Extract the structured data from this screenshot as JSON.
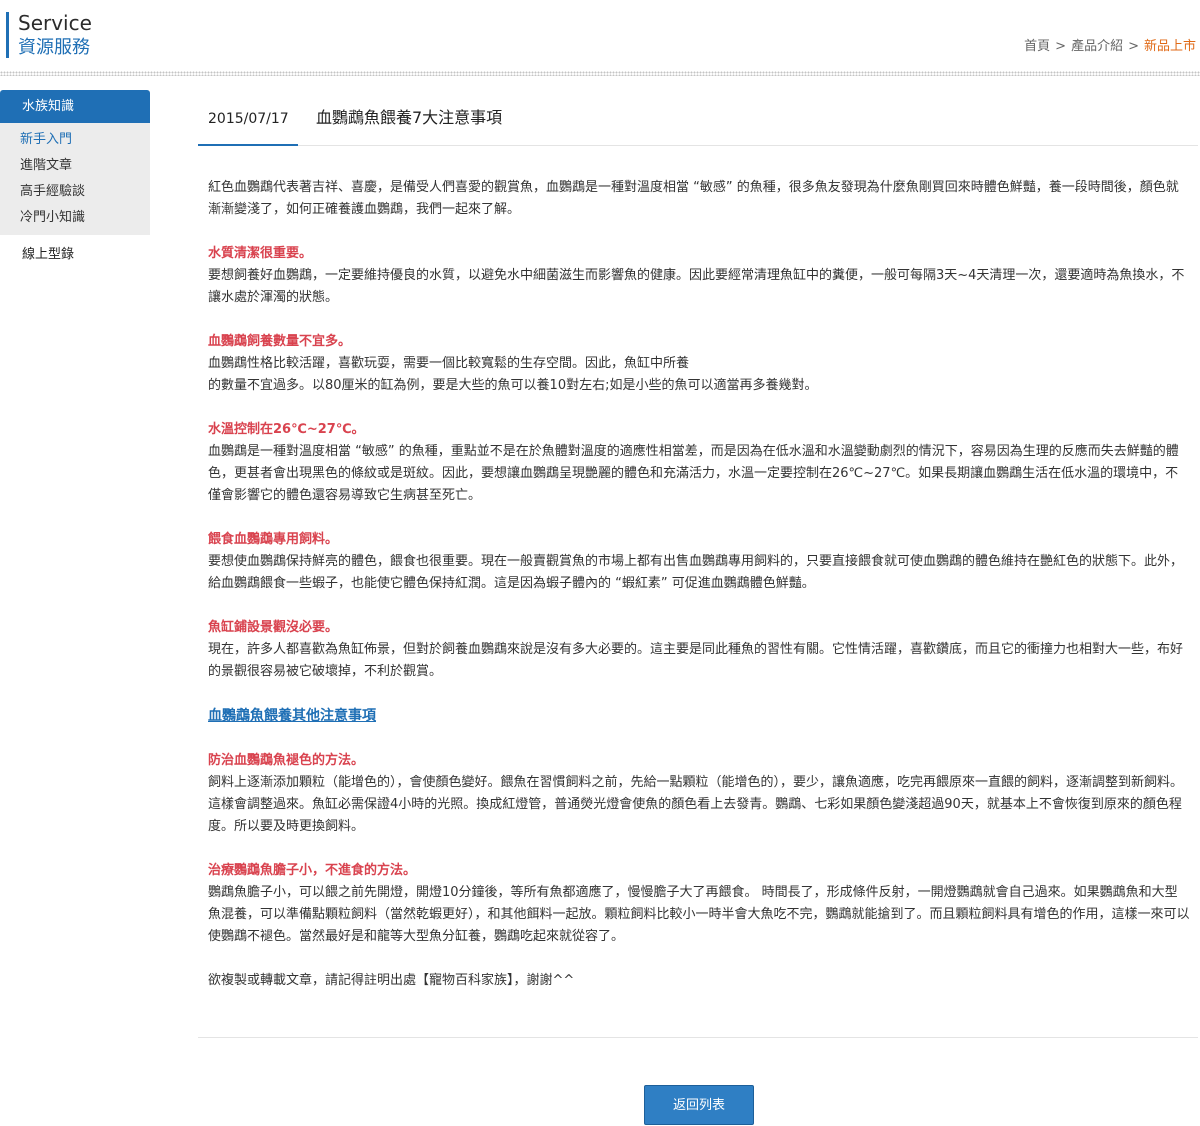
{
  "header": {
    "title_en": "Service",
    "title_zh": "資源服務"
  },
  "breadcrumb": {
    "home": "首頁",
    "products": "產品介紹",
    "current": "新品上市",
    "separator": ">"
  },
  "sidebar": {
    "heading": "水族知識",
    "items": [
      {
        "label": "新手入門"
      },
      {
        "label": "進階文章"
      },
      {
        "label": "高手經驗談"
      },
      {
        "label": "冷門小知識"
      }
    ],
    "catalog": "線上型錄"
  },
  "article": {
    "date": "2015/07/17",
    "title": "血鸚鵡魚餵養7大注意事項",
    "intro": "紅色血鸚鵡代表著吉祥、喜慶，是備受人們喜愛的觀賞魚，血鸚鵡是一種對溫度相當 “敏感” 的魚種，很多魚友發現為什麼魚剛買回來時體色鮮豔，養一段時間後，顏色就漸漸變淺了，如何正確養護血鸚鵡，我們一起來了解。",
    "s1_title": "水質清潔很重要。",
    "s1_body": "要想飼養好血鸚鵡，一定要維持優良的水質，以避免水中細菌滋生而影響魚的健康。因此要經常清理魚缸中的糞便，一般可每隔3天~4天清理一次，還要適時為魚換水，不讓水處於渾濁的狀態。",
    "s2_title": "血鸚鵡飼養數量不宜多。",
    "s2_body1": "血鸚鵡性格比較活躍，喜歡玩耍，需要一個比較寬鬆的生存空間。因此，魚缸中所養",
    "s2_body2": "的數量不宜過多。以80厘米的缸為例，要是大些的魚可以養10對左右;如是小些的魚可以適當再多養幾對。",
    "s3_title": "水溫控制在26℃~27℃。",
    "s3_body": "血鸚鵡是一種對溫度相當 “敏感” 的魚種，重點並不是在於魚體對溫度的適應性相當差，而是因為在低水溫和水溫變動劇烈的情況下，容易因為生理的反應而失去鮮豔的體色，更甚者會出現黑色的條紋或是斑紋。因此，要想讓血鸚鵡呈現艷麗的體色和充滿活力，水溫一定要控制在26℃~27℃。如果長期讓血鸚鵡生活在低水溫的環境中，不僅會影響它的體色還容易導致它生病甚至死亡。",
    "s4_title": "餵食血鸚鵡專用飼料。",
    "s4_body": "要想使血鸚鵡保持鮮亮的體色，餵食也很重要。現在一般賣觀賞魚的市場上都有出售血鸚鵡專用飼料的，只要直接餵食就可使血鸚鵡的體色維持在艷紅色的狀態下。此外，給血鸚鵡餵食一些蝦子，也能使它體色保持紅潤。這是因為蝦子體內的 “蝦紅素” 可促進血鸚鵡體色鮮豔。",
    "s5_title": "魚缸鋪設景觀沒必要。",
    "s5_body": "現在，許多人都喜歡為魚缸佈景，但對於飼養血鸚鵡來說是沒有多大必要的。這主要是同此種魚的習性有關。它性情活躍，喜歡鑽底，而且它的衝撞力也相對大一些，布好的景觀很容易被它破壞掉，不利於觀賞。",
    "link": "血鸚鵡魚餵養其他注意事項",
    "s6_title": "防治血鸚鵡魚褪色的方法。",
    "s6_body": "飼料上逐漸添加顆粒（能增色的），會使顏色變好。餵魚在習慣飼料之前，先給一點顆粒（能增色的），要少，讓魚適應，吃完再餵原來一直餵的飼料，逐漸調整到新飼料。這樣會調整過來。魚缸必需保證4小時的光照。換成紅燈管，普通熒光燈會使魚的顏色看上去發青。鸚鵡、七彩如果顏色變淺超過90天，就基本上不會恢復到原來的顏色程度。所以要及時更換飼料。",
    "s7_title": "治療鸚鵡魚膽子小，不進食的方法。",
    "s7_body": "鸚鵡魚膽子小，可以餵之前先開燈，開燈10分鐘後，等所有魚都適應了，慢慢膽子大了再餵食。 時間長了，形成條件反射，一開燈鸚鵡就會自己過來。如果鸚鵡魚和大型魚混養，可以準備點顆粒飼料（當然乾蝦更好），和其他餌料一起放。顆粒飼料比較小一時半會大魚吃不完，鸚鵡就能搶到了。而且顆粒飼料具有增色的作用，這樣一來可以使鸚鵡不褪色。當然最好是和龍等大型魚分缸養，鸚鵡吃起來就從容了。",
    "footer_note": "欲複製或轉載文章，請記得註明出處【寵物百科家族】，謝謝^^"
  },
  "actions": {
    "back": "返回列表"
  },
  "colors": {
    "accent": "#1f6fb5",
    "section_heading": "#d9434f",
    "breadcrumb_current": "#e06a17"
  }
}
